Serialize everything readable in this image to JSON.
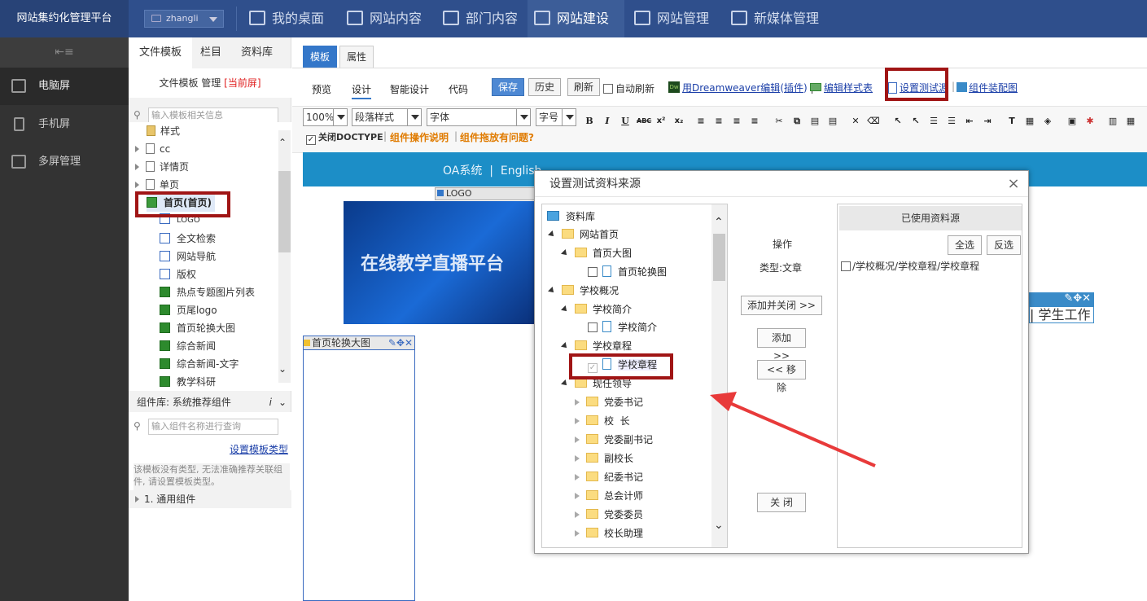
{
  "app": {
    "title": "网站集约化管理平台",
    "user": "zhangli"
  },
  "nav": [
    {
      "label": "我的桌面"
    },
    {
      "label": "网站内容"
    },
    {
      "label": "部门内容"
    },
    {
      "label": "网站建设"
    },
    {
      "label": "网站管理"
    },
    {
      "label": "新媒体管理"
    }
  ],
  "sidebar": {
    "items": [
      {
        "label": "电脑屏"
      },
      {
        "label": "手机屏"
      },
      {
        "label": "多屏管理"
      }
    ]
  },
  "filepanel": {
    "tabs": [
      "文件模板",
      "栏目",
      "资料库"
    ],
    "title": "文件模板 管理",
    "current": "[当前屏]",
    "search_placeholder": "输入模板相关信息",
    "tree": [
      "样式",
      "cc",
      "详情页",
      "单页",
      "首页(首页)",
      "LOGO",
      "全文检索",
      "网站导航",
      "版权",
      "热点专题图片列表",
      "页尾logo",
      "首页轮换大图",
      "综合新闻",
      "综合新闻-文字",
      "教学科研"
    ],
    "component_lib": "组件库: 系统推荐组件",
    "comp_search_placeholder": "输入组件名称进行查询",
    "set_type_link": "设置模板类型",
    "notice": "该模板没有类型, 无法准确推荐关联组件, 请设置模板类型。",
    "general": "1. 通用组件"
  },
  "editor": {
    "tabs": [
      "模板",
      "属性"
    ],
    "subtabs": [
      "预览",
      "设计",
      "智能设计",
      "代码"
    ],
    "buttons": {
      "save": "保存",
      "history": "历史",
      "refresh": "刷新",
      "auto_refresh": "自动刷新"
    },
    "links": {
      "dreamweaver": "用Dreamweaver编辑",
      "plugin": "插件",
      "edit_style": "编辑样式表",
      "set_test": "设置测试源",
      "assembly": "组件装配图"
    },
    "format": {
      "zoom": "100%",
      "para": "段落样式",
      "font": "字体",
      "size": "字号"
    },
    "doctype_label": "关闭DOCTYPE",
    "help1": "组件操作说明",
    "help2": "组件拖放有问题?"
  },
  "preview": {
    "topbar": "OA系统  |  English",
    "logo_label": "LOGO",
    "banner": "在线教学直播平台",
    "carousel_label": "首页轮换大图",
    "student": "| 学生工作"
  },
  "dialog": {
    "title": "设置测试资料来源",
    "tree": [
      {
        "label": "资料库"
      },
      {
        "label": "网站首页"
      },
      {
        "label": "首页大图"
      },
      {
        "label": "首页轮换图"
      },
      {
        "label": "学校概况"
      },
      {
        "label": "学校简介"
      },
      {
        "label": "学校简介"
      },
      {
        "label": "学校章程"
      },
      {
        "label": "学校章程"
      },
      {
        "label": "现任领导"
      },
      {
        "label": "党委书记"
      },
      {
        "label": "校  长"
      },
      {
        "label": "党委副书记"
      },
      {
        "label": "副校长"
      },
      {
        "label": "纪委书记"
      },
      {
        "label": "总会计师"
      },
      {
        "label": "党委委员"
      },
      {
        "label": "校长助理"
      }
    ],
    "op_title": "操作",
    "op_type": "类型:文章",
    "add_close": "添加并关闭 >>",
    "add": "添加 >>",
    "remove": "<< 移除",
    "close": "关 闭",
    "used_title": "已使用资料源",
    "select_all": "全选",
    "invert": "反选",
    "used_item": "/学校概况/学校章程/学校章程"
  },
  "colors": {
    "topbar": "#2f4f8c",
    "accent": "#3477c9",
    "highlight": "#a01515",
    "arrow": "#e83a3a"
  }
}
